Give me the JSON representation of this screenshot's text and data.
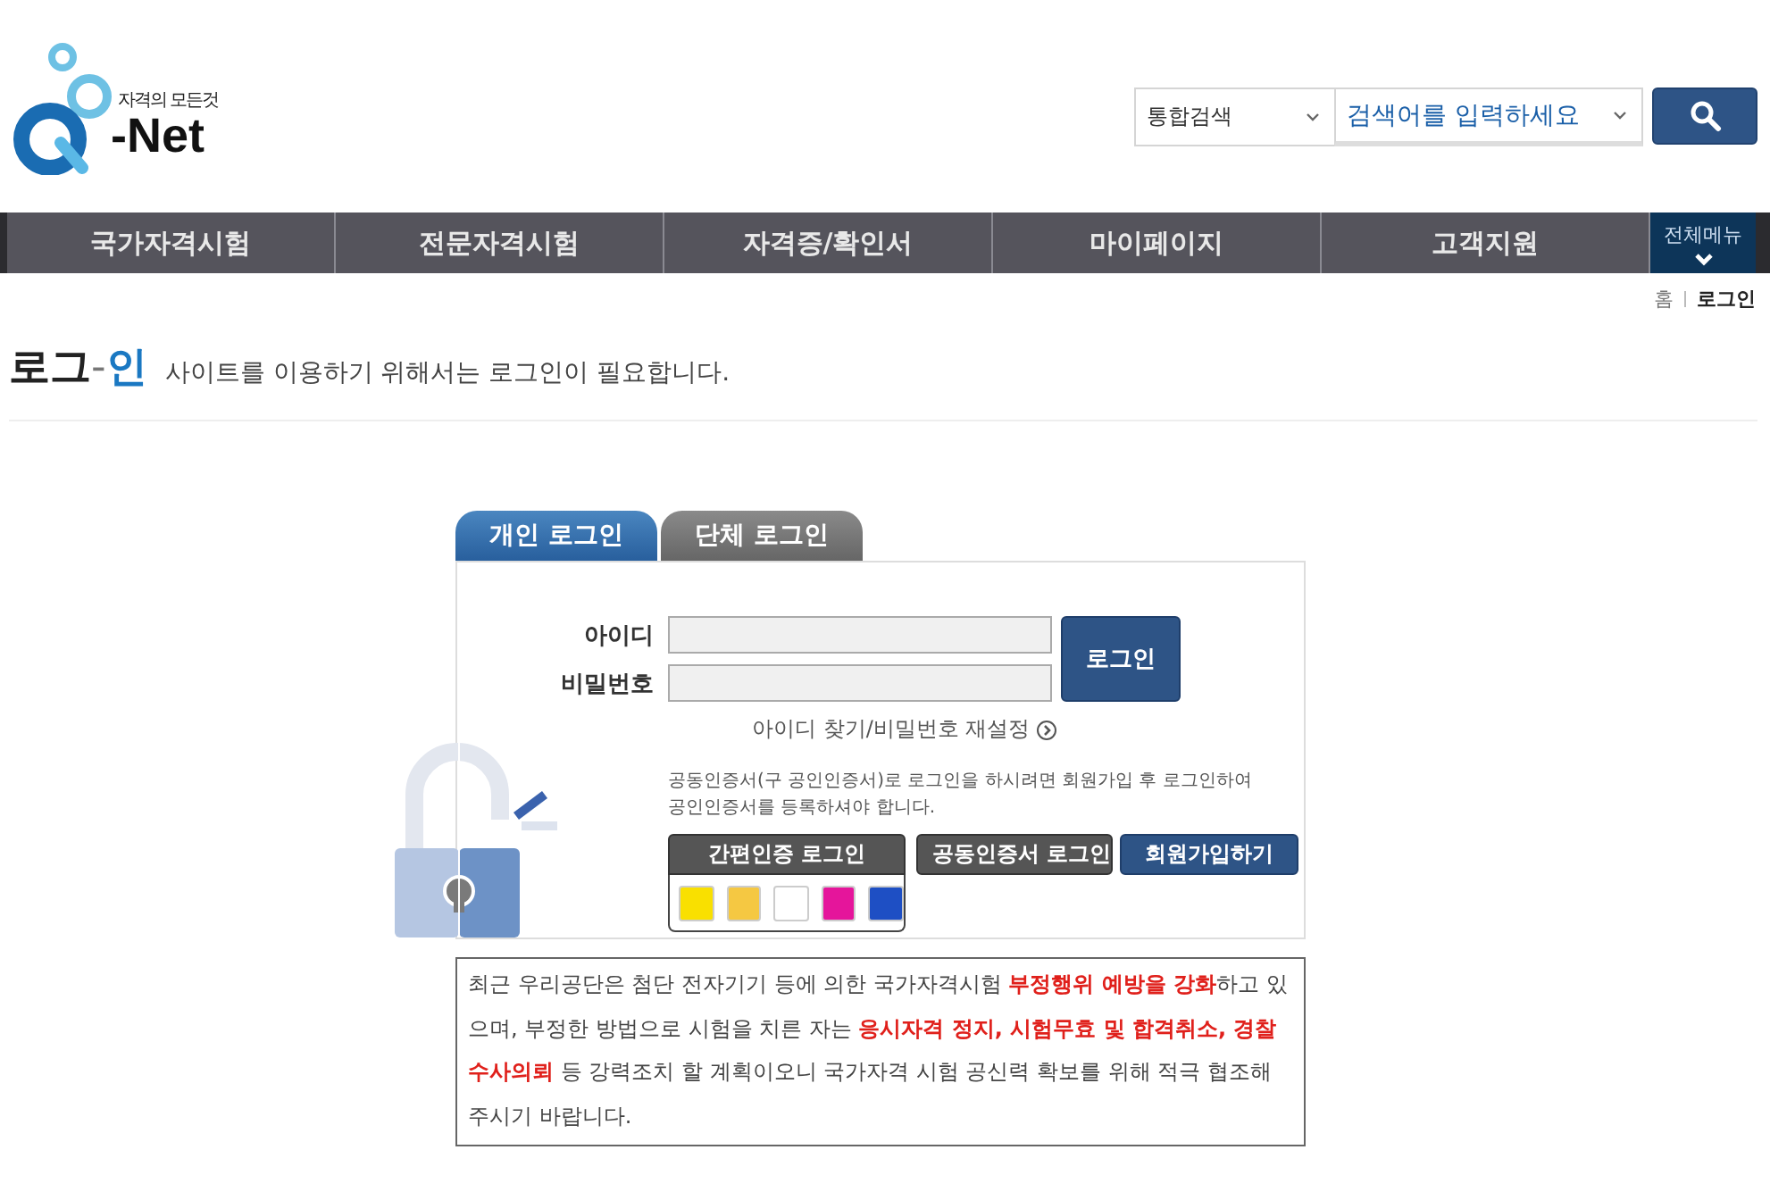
{
  "logo": {
    "tagline": "자격의 모든것",
    "wordmark": "-Net"
  },
  "search": {
    "scope": "통합검색",
    "placeholder": "검색어를 입력하세요"
  },
  "nav": {
    "items": [
      {
        "label": "국가자격시험"
      },
      {
        "label": "전문자격시험"
      },
      {
        "label": "자격증/확인서"
      },
      {
        "label": "마이페이지"
      },
      {
        "label": "고객지원"
      }
    ],
    "all_menu": "전체메뉴"
  },
  "breadcrumb": [
    "홈",
    "로그인"
  ],
  "heading": {
    "parts": [
      {
        "text": "로그",
        "kind": "dark"
      },
      {
        "text": "-",
        "kind": "dash"
      },
      {
        "text": "인",
        "kind": "accent"
      }
    ],
    "subtitle": "사이트를 이용하기 위해서는 로그인이 필요합니다."
  },
  "login": {
    "tabs": [
      {
        "label": "개인 로그인",
        "selected": true
      },
      {
        "label": "단체 로그인",
        "selected": false
      }
    ],
    "fields": [
      {
        "label": "아이디"
      },
      {
        "label": "비밀번호"
      }
    ],
    "submit": "로그인",
    "find_link": "아이디 찾기/비밀번호 재설정",
    "cert_note": "공동인증서(구 공인인증서)로 로그인을 하시려면 회원가입 후 로그인하여 공인인증서를 등록하셔야 합니다.",
    "simple_auth": {
      "label": "간편인증 로그인",
      "providers": [
        {
          "color": "#f9e000"
        },
        {
          "color": "#f5c842"
        },
        {
          "color": "#ffffff"
        },
        {
          "color": "#e5159b"
        },
        {
          "color": "#1e4fc4"
        }
      ]
    },
    "buttons": [
      {
        "label": "공동인증서 로그인",
        "kind": "dark"
      },
      {
        "label": "회원가입하기",
        "kind": "primary"
      }
    ]
  },
  "notice": "최근 우리공단은 첨단 전자기기 등에 의한 국가자격시험 **부정행위 예방을 강화**하고 있으며, 부정한 방법으로 시험을 치른 자는 **응시자격 정지, 시험무효 및 합격취소, 경찰 수사의뢰** 등 강력조치 할 계획이오니 국가자격 시험 공신력 확보를 위해 적극 협조해주시기 바랍니다."
}
